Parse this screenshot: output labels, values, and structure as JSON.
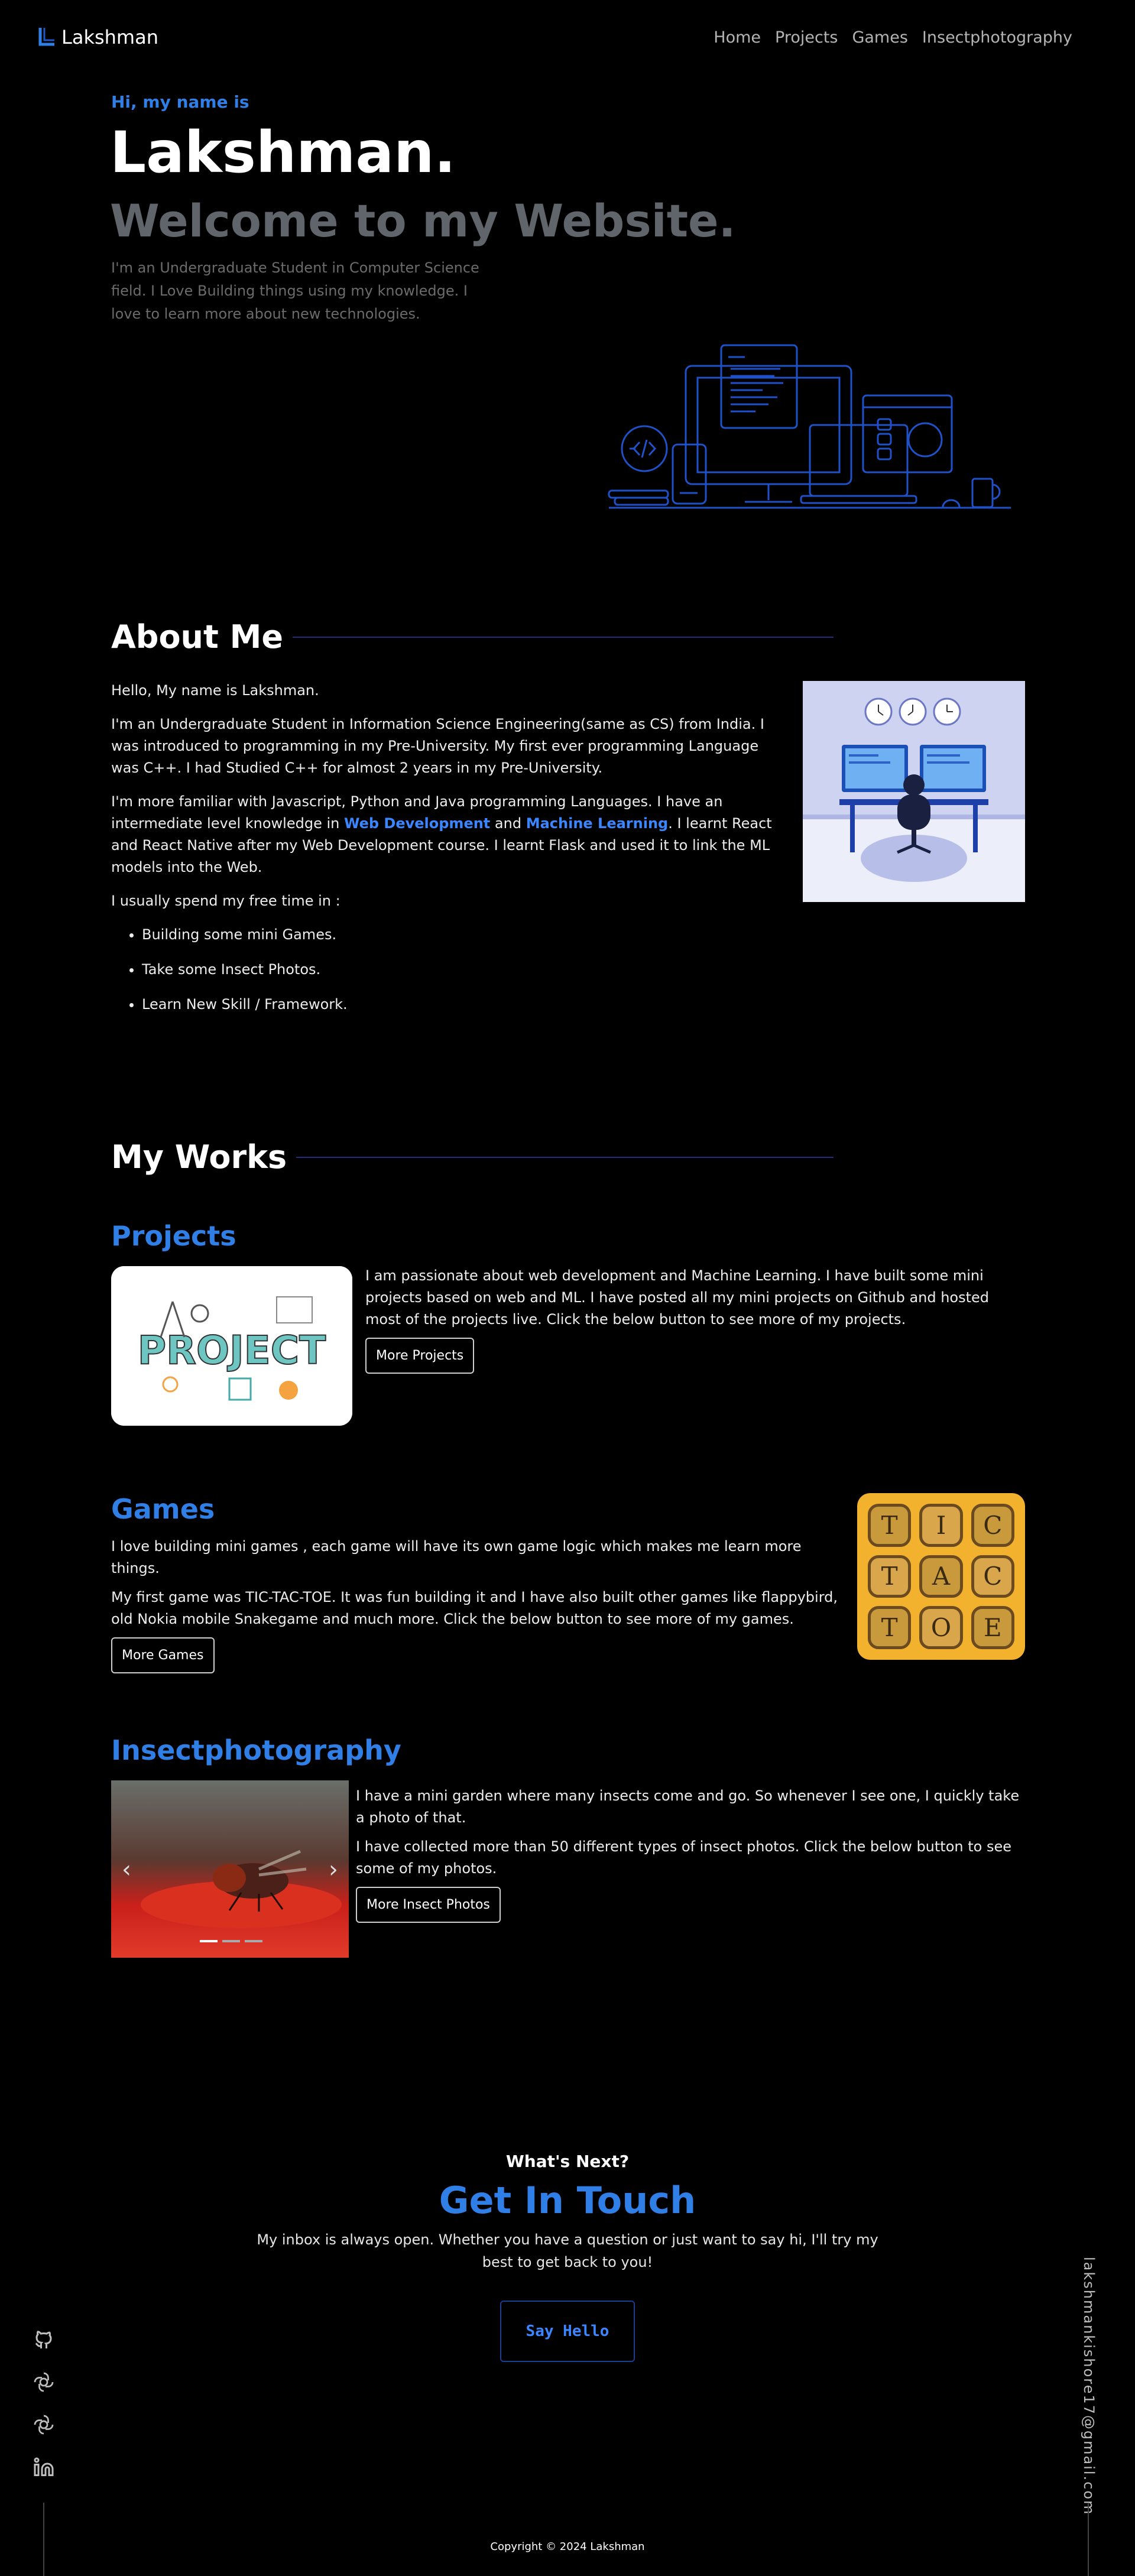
{
  "header": {
    "logo_text": "Lakshman",
    "nav": [
      "Home",
      "Projects",
      "Games",
      "Insectphotography"
    ]
  },
  "hero": {
    "greeting": "Hi, my name is",
    "name": "Lakshman.",
    "welcome": "Welcome to my Website.",
    "intro": "I'm an Undergraduate Student in Computer Science field. I Love Building things using my knowledge. I love to learn more about new technologies."
  },
  "about": {
    "heading": "About Me",
    "p1": "Hello, My name is Lakshman.",
    "p2": "I'm an Undergraduate Student in Information Science Engineering(same as CS) from India. I was introduced to programming in my Pre-University. My first ever programming Language was C++. I had Studied C++ for almost 2 years in my Pre-University.",
    "p3_a": "I'm more familiar with Javascript, Python and Java programming Languages. I have an intermediate level knowledge in ",
    "p3_hl1": "Web Development",
    "p3_b": " and ",
    "p3_hl2": "Machine Learning",
    "p3_c": ". I learnt React and React Native after my Web Development course. I learnt Flask and used it to link the ML models into the Web.",
    "p4": "I usually spend my free time in :",
    "list": [
      "Building some mini Games.",
      "Take some Insect Photos.",
      "Learn New Skill / Framework."
    ]
  },
  "works": {
    "heading": "My Works",
    "projects": {
      "title": "Projects",
      "image_text": "PROJECT",
      "text": "I am passionate about web development and Machine Learning. I have built some mini projects based on web and ML. I have posted all my mini projects on Github and hosted most of the projects live. Click the below button to see more of my projects.",
      "button": "More Projects"
    },
    "games": {
      "title": "Games",
      "tiles": [
        "T",
        "I",
        "C",
        "T",
        "A",
        "C",
        "T",
        "O",
        "E"
      ],
      "p1": "I love building mini games , each game will have its own game logic which makes me learn more things.",
      "p2": "My first game was TIC-TAC-TOE. It was fun building it and I have also built other games like flappybird, old Nokia mobile Snakegame and much more. Click the below button to see more of my games.",
      "button": "More Games"
    },
    "insects": {
      "title": "Insectphotography",
      "p1": "I have a mini garden where many insects come and go. So whenever I see one, I quickly take a photo of that.",
      "p2": "I have collected more than 50 different types of insect photos. Click the below button to see some of my photos.",
      "button": "More Insect Photos",
      "prev": "‹",
      "next": "›"
    }
  },
  "contact": {
    "kicker": "What's Next?",
    "title": "Get In Touch",
    "text": "My inbox is always open. Whether you have a question or just want to say hi, I'll try my best to get back to you!",
    "button": "Say Hello"
  },
  "side": {
    "icons": [
      "github-icon",
      "openai-icon",
      "openai-icon",
      "linkedin-icon"
    ],
    "email": "lakshmankishore17@gmail.com"
  },
  "footer": {
    "copyright": "Copyright © 2024 Lakshman"
  },
  "colors": {
    "accent": "#2f7fe6",
    "background": "#000000",
    "muted": "#5f656b"
  }
}
